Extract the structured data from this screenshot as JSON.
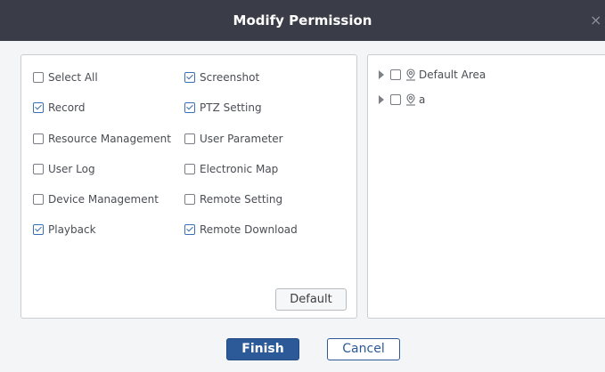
{
  "dialog": {
    "title": "Modify Permission",
    "close_glyph": "×"
  },
  "permissions": [
    {
      "label": "Select All",
      "checked": false
    },
    {
      "label": "Screenshot",
      "checked": true
    },
    {
      "label": "Record",
      "checked": true
    },
    {
      "label": "PTZ Setting",
      "checked": true
    },
    {
      "label": "Resource Management",
      "checked": false
    },
    {
      "label": "User Parameter",
      "checked": false
    },
    {
      "label": "User Log",
      "checked": false
    },
    {
      "label": "Electronic Map",
      "checked": false
    },
    {
      "label": "Device Management",
      "checked": false
    },
    {
      "label": "Remote Setting",
      "checked": false
    },
    {
      "label": "Playback",
      "checked": true
    },
    {
      "label": "Remote Download",
      "checked": true
    }
  ],
  "default_button": "Default",
  "area_tree": [
    {
      "label": "Default Area",
      "checked": false,
      "icon": "location-pin-icon"
    },
    {
      "label": "a",
      "checked": false,
      "icon": "location-pin-icon"
    }
  ],
  "footer": {
    "finish_label": "Finish",
    "cancel_label": "Cancel"
  },
  "colors": {
    "titlebar": "#3a3d47",
    "accent": "#2c5a98",
    "check": "#3a6fb3"
  }
}
